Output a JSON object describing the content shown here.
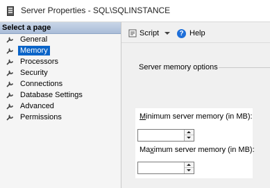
{
  "window": {
    "title": "Server Properties - SQL\\SQLINSTANCE"
  },
  "sidebar": {
    "header": "Select a page",
    "items": [
      {
        "label": "General",
        "selected": false
      },
      {
        "label": "Memory",
        "selected": true
      },
      {
        "label": "Processors",
        "selected": false
      },
      {
        "label": "Security",
        "selected": false
      },
      {
        "label": "Connections",
        "selected": false
      },
      {
        "label": "Database Settings",
        "selected": false
      },
      {
        "label": "Advanced",
        "selected": false
      },
      {
        "label": "Permissions",
        "selected": false
      }
    ],
    "item_icon": "wrench-icon"
  },
  "toolbar": {
    "script_label": "Script",
    "help_label": "Help"
  },
  "main": {
    "section_title": "Server memory options",
    "min_memory": {
      "label_accel": "M",
      "label_rest": "inimum server memory (in MB):",
      "value": ""
    },
    "max_memory": {
      "label_pre": "Ma",
      "label_accel": "x",
      "label_rest": "imum server memory (in MB):",
      "value": ""
    }
  },
  "colors": {
    "selection": "#0a64c8",
    "header_gradient": "#b5c6de",
    "help_icon": "#1e6fd9"
  }
}
